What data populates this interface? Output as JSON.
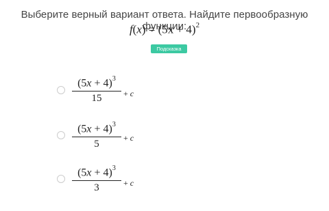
{
  "question": {
    "text": "Выберите верный вариант ответа. Найдите первообразную функции:",
    "formula_lhs": "f",
    "formula_arg": "x",
    "formula_rhs": "(5x + 4)",
    "formula_exp": "2"
  },
  "hint_button": {
    "label": "Подсказка"
  },
  "options": [
    {
      "numerator_open": "(5",
      "numerator_var": "x",
      "numerator_close": " + 4)",
      "exponent": "3",
      "denominator": "15",
      "suffix_plus": "+",
      "suffix_const": "c"
    },
    {
      "numerator_open": "(5",
      "numerator_var": "x",
      "numerator_close": " + 4)",
      "exponent": "3",
      "denominator": "5",
      "suffix_plus": "+",
      "suffix_const": "c"
    },
    {
      "numerator_open": "(5",
      "numerator_var": "x",
      "numerator_close": " + 4)",
      "exponent": "3",
      "denominator": "3",
      "suffix_plus": "+",
      "suffix_const": "c"
    }
  ],
  "colors": {
    "hint_button_bg": "#3cc9a2",
    "radio_border": "#cccccc",
    "text": "#444444"
  }
}
